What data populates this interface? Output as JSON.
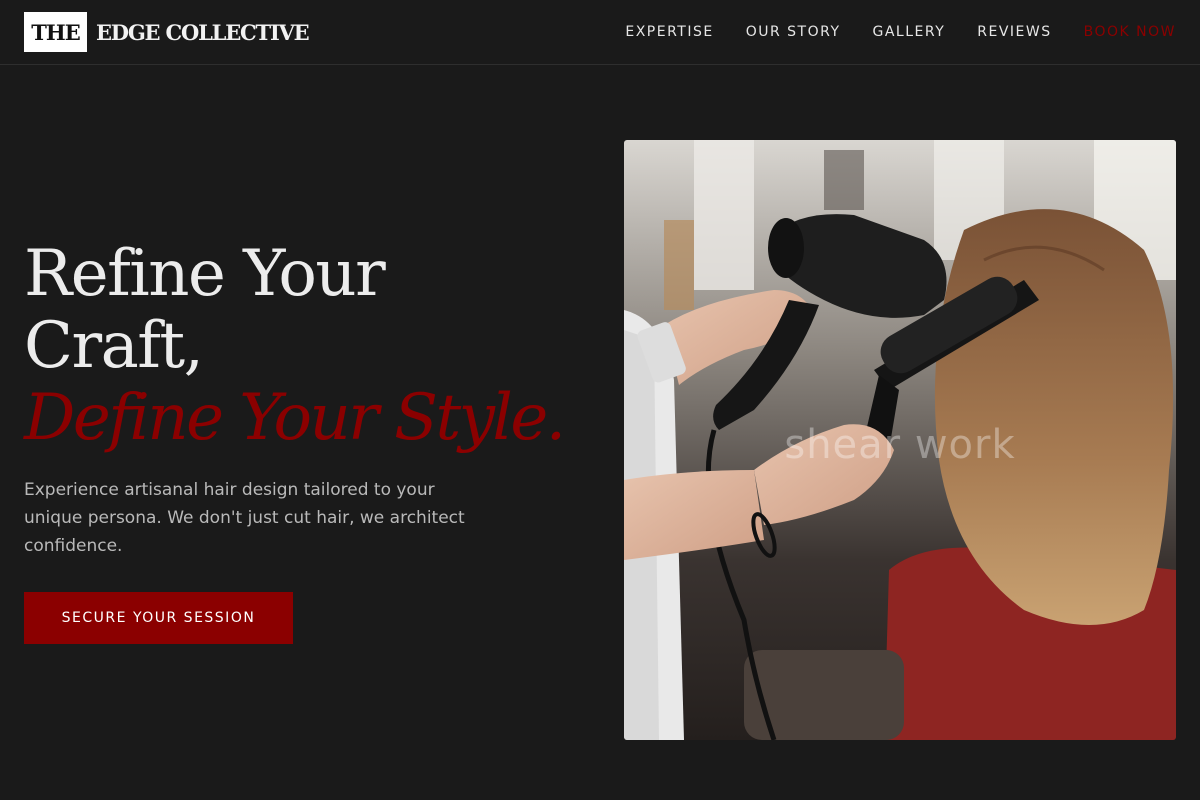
{
  "brand": {
    "logo_box": "THE",
    "logo_text": "EDGE COLLECTIVE"
  },
  "nav": {
    "items": [
      {
        "label": "EXPERTISE"
      },
      {
        "label": "OUR STORY"
      },
      {
        "label": "GALLERY"
      },
      {
        "label": "REVIEWS"
      }
    ],
    "book_label": "BOOK NOW"
  },
  "hero": {
    "title_line1": "Refine Your",
    "title_line2": "Craft,",
    "title_accent": "Define Your Style.",
    "description": "Experience artisanal hair design tailored to your unique persona. We don't just cut hair, we architect confidence.",
    "cta_label": "SECURE YOUR SESSION",
    "image_watermark": "shear work"
  },
  "colors": {
    "accent": "#8b0000",
    "background": "#1a1a1a"
  }
}
